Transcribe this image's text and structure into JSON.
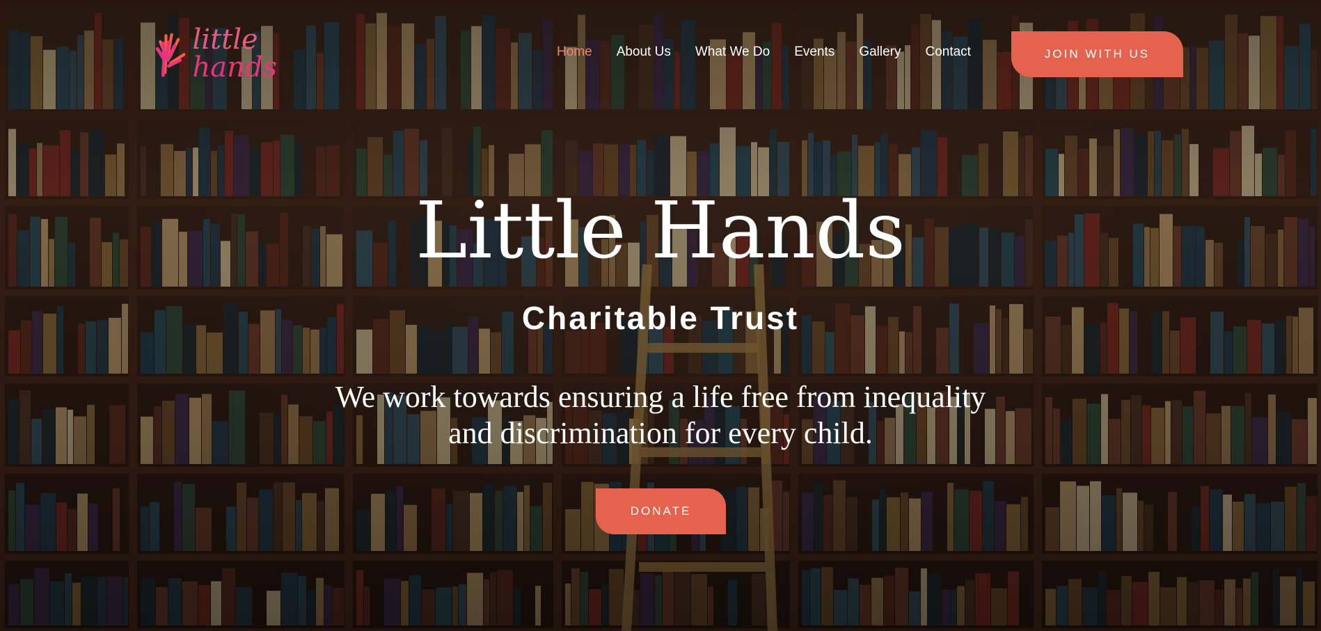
{
  "brand": {
    "logo_line1": "little",
    "logo_line2": "hands",
    "hand_color": "#e8357a"
  },
  "nav": {
    "items": [
      "Home",
      "About Us",
      "What We Do",
      "Events",
      "Gallery",
      "Contact"
    ],
    "active": "Home"
  },
  "header": {
    "join_label": "JOIN WITH US"
  },
  "hero": {
    "title": "Little Hands",
    "subtitle": "Charitable Trust",
    "mission": "We work towards ensuring a life free from inequality and discrimination for every child.",
    "donate_label": "DONATE"
  },
  "colors": {
    "accent": "#e4624e",
    "active_nav": "#f0846e",
    "text": "#ffffff"
  }
}
